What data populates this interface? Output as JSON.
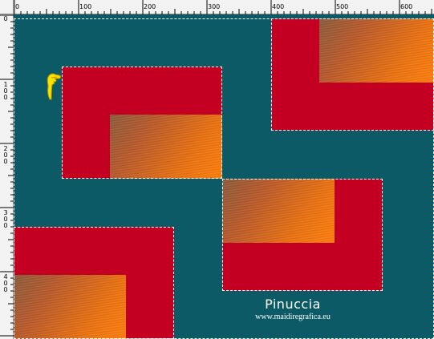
{
  "rulers": {
    "top_labels": [
      "0",
      "100",
      "200",
      "300",
      "400",
      "500",
      "600"
    ],
    "left_labels": [
      "0",
      "100",
      "200",
      "300",
      "400"
    ]
  },
  "canvas": {
    "colors": {
      "background": "#0b5a66",
      "red": "#c30021",
      "orange": "#ff7d0a"
    }
  },
  "watermark": {
    "name": "Pinuccia",
    "url": "www.maidiregrafica.eu"
  },
  "cursor": {
    "icon": "pointing-hand-icon"
  }
}
